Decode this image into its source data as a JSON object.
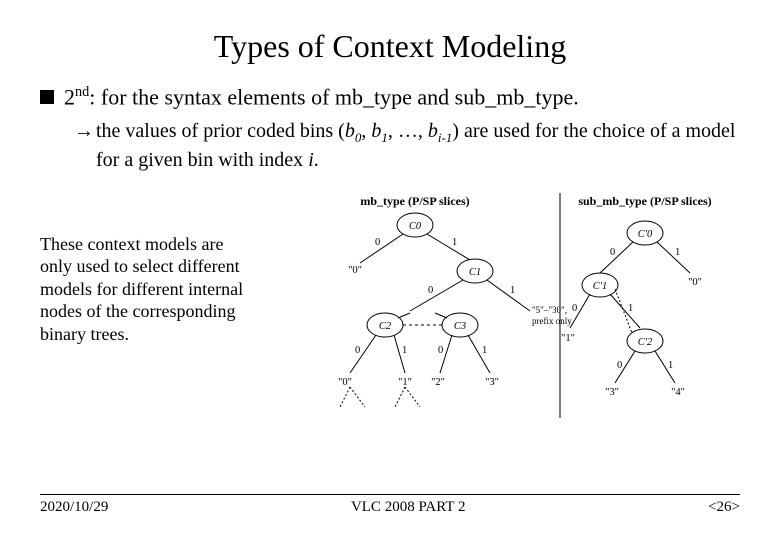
{
  "title": "Types of Context Modeling",
  "bullet": {
    "prefix": "2",
    "super": "nd",
    "rest1": ": for the syntax elements of ",
    "term1": "mb_type",
    "mid": " and ",
    "term2": "sub_mb_type",
    "end": "."
  },
  "arrow": {
    "t1": "the values of prior coded bins (",
    "b": "b",
    "s0": "0",
    "c1": ", ",
    "s1": "1",
    "c2": ", …, ",
    "si": "i-1",
    "t2": ") are used for the choice of a model for a given bin with index ",
    "ivar": "i",
    "t3": "."
  },
  "caption": "These context models are only used to select different models for different internal nodes of the corresponding binary trees.",
  "diagram": {
    "leftHeader": "mb_type (P/SP slices)",
    "rightHeader": "sub_mb_type (P/SP slices)",
    "nodes": {
      "c0": "C0",
      "c1": "C1",
      "c2": "C2",
      "c3": "C3",
      "cp0": "C'0",
      "cp1": "C'1",
      "cp2": "C'2"
    },
    "edges": {
      "zero": "0",
      "one": "1"
    },
    "leaves": {
      "l0q": "\"0\"",
      "l1q": "\"1\"",
      "l2q": "\"2\"",
      "l3q": "\"3\"",
      "l4q": "\"4\"",
      "five30": "\"5\"–\"30\",",
      "prefix": "prefix only"
    }
  },
  "footer": {
    "date": "2020/10/29",
    "center": "VLC 2008 PART 2",
    "page": "<26>"
  }
}
